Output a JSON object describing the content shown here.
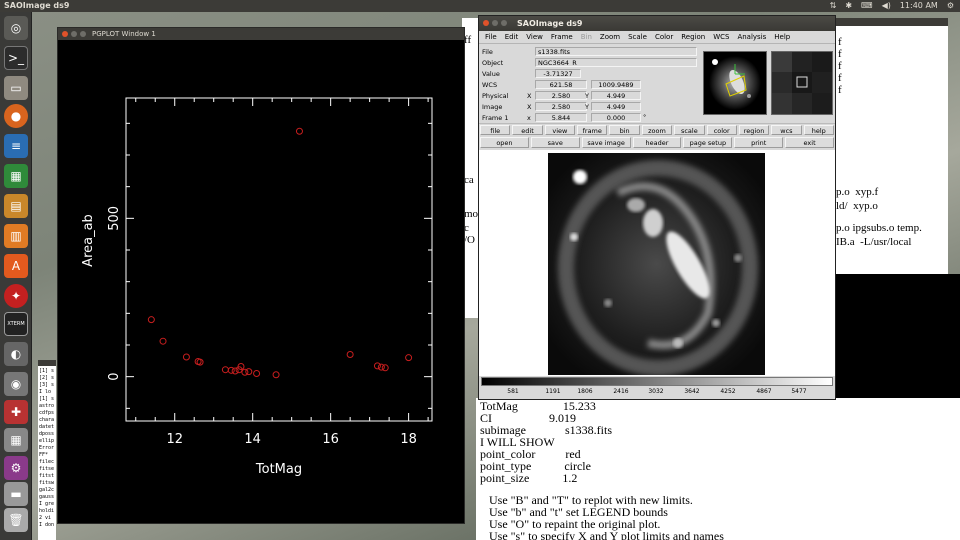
{
  "top_panel": {
    "app_title": "SAOImage ds9",
    "time": "11:40 AM",
    "tray_icons": [
      "network-icon",
      "bluetooth-icon",
      "keyboard-icon",
      "volume-icon",
      "clock",
      "gear-icon"
    ]
  },
  "launcher": {
    "items": [
      "ubuntu-dash-icon",
      "terminal-icon",
      "files-icon",
      "firefox-icon",
      "writer-icon",
      "calc-icon",
      "impress-icon",
      "document-icon",
      "software-center-icon",
      "tool-icon",
      "xterm-icon",
      "mouse-icon",
      "camera-icon",
      "settings-icon",
      "calculator-icon",
      "system-settings-icon",
      "disk-icon",
      "trash-icon"
    ],
    "xterm_label": "XTERM"
  },
  "pgplot": {
    "window_title": "PGPLOT Window 1",
    "chart_data": {
      "type": "scatter",
      "xlabel": "TotMag",
      "ylabel": "Area_ab",
      "xlim": [
        10.75,
        18.6
      ],
      "ylim": [
        -140,
        880
      ],
      "xticks": [
        12,
        14,
        16,
        18
      ],
      "yticks": [
        0,
        500
      ],
      "point_color": "#c81e1e",
      "point_type": "circle",
      "points": [
        {
          "x": 11.4,
          "y": 180
        },
        {
          "x": 11.7,
          "y": 112
        },
        {
          "x": 12.3,
          "y": 62
        },
        {
          "x": 12.6,
          "y": 48
        },
        {
          "x": 12.65,
          "y": 46
        },
        {
          "x": 13.3,
          "y": 22
        },
        {
          "x": 13.45,
          "y": 20
        },
        {
          "x": 13.55,
          "y": 18
        },
        {
          "x": 13.65,
          "y": 22
        },
        {
          "x": 13.7,
          "y": 32
        },
        {
          "x": 13.8,
          "y": 14
        },
        {
          "x": 13.9,
          "y": 16
        },
        {
          "x": 14.1,
          "y": 10
        },
        {
          "x": 14.6,
          "y": 6
        },
        {
          "x": 15.2,
          "y": 775
        },
        {
          "x": 16.5,
          "y": 70
        },
        {
          "x": 17.2,
          "y": 34
        },
        {
          "x": 17.3,
          "y": 30
        },
        {
          "x": 17.4,
          "y": 28
        },
        {
          "x": 18.0,
          "y": 60
        }
      ]
    }
  },
  "ds9": {
    "window_title": "SAOImage ds9",
    "menu": [
      "File",
      "Edit",
      "View",
      "Frame",
      "Bin",
      "Zoom",
      "Scale",
      "Color",
      "Region",
      "WCS",
      "Analysis",
      "Help"
    ],
    "info": {
      "file_label": "File",
      "file_value": "s1338.fits",
      "object_label": "Object",
      "object_value": "NGC3664_R",
      "value_label": "Value",
      "value_value": "-3.71327",
      "wcs_label": "WCS",
      "wcs_x": "621.58",
      "wcs_y": "1009.9489",
      "physical_label": "Physical",
      "physical_x": "2.580",
      "physical_y": "4.949",
      "image_label": "Image",
      "image_x": "2.580",
      "image_y": "4.949",
      "frame_label": "Frame 1",
      "frame_x": "5.844",
      "frame_y": "0.000",
      "x_label": "X",
      "y_label": "Y",
      "x_label_lower": "x",
      "degree": "°"
    },
    "buttons_row1": [
      "file",
      "edit",
      "view",
      "frame",
      "bin",
      "zoom",
      "scale",
      "color",
      "region",
      "wcs",
      "help"
    ],
    "buttons_row2": [
      "open",
      "save",
      "save image",
      "header",
      "page setup",
      "print",
      "exit"
    ],
    "colorbar_labels": [
      "581",
      "1191",
      "1806",
      "2416",
      "3032",
      "3642",
      "4252",
      "4867",
      "5477"
    ]
  },
  "term_right": {
    "lines": [
      "f",
      "f",
      "f",
      "f",
      "f",
      "p.o  xyp.f",
      "ld/  xyp.o",
      "p.o ipgsubs.o temp.",
      "IB.a  -L/usr/local"
    ]
  },
  "term_back": {
    "lines": [
      "ff",
      "ca",
      "mo",
      "c",
      "/O"
    ]
  },
  "term_left_small": {
    "lines": [
      "[1] s",
      "[2] s",
      "[3] s",
      "I lo",
      "[1] s",
      "astro",
      "cdfps",
      "chara",
      "datet",
      "dposs",
      "ellip",
      "Error",
      "FF*",
      "filec",
      "fitse",
      "fitst",
      "fitsw",
      "gal2c",
      "gauss",
      "I gre",
      "holdi",
      "2 vi",
      "I don"
    ]
  },
  "term_bottom": {
    "lines": [
      "TotMag               15.233",
      "CI                   9.019",
      "subimage             s1338.fits",
      "I WILL SHOW",
      "point_color          red",
      "point_type           circle",
      "point_size           1.2",
      "",
      "   Use \"B\" and \"T\" to replot with new limits.",
      "   Use \"b\" and \"t\" set LEGEND bounds",
      "   Use \"O\" to repaint the original plot.",
      "   Use \"s\" to specify X and Y plot limits and names"
    ]
  }
}
